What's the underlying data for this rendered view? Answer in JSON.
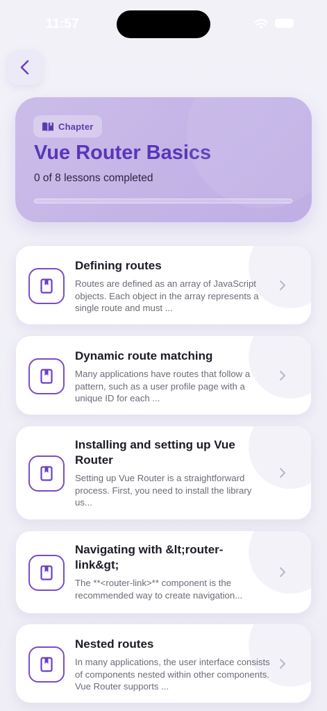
{
  "status_bar": {
    "time": "11:57"
  },
  "header": {
    "back_label": ""
  },
  "chapter": {
    "badge": "Chapter",
    "title": "Vue Router Basics",
    "progress_text": "0 of 8 lessons completed",
    "progress_fraction": 0
  },
  "lessons": [
    {
      "title": "Defining routes",
      "description": "Routes are defined as an array of JavaScript objects. Each object in the array represents a single route and must ..."
    },
    {
      "title": "Dynamic route matching",
      "description": "Many applications have routes that follow a pattern, such as a user profile page with a unique ID for each ..."
    },
    {
      "title": "Installing and setting up Vue Router",
      "description": "Setting up Vue Router is a straightforward process. First, you need to install the library us..."
    },
    {
      "title": "Navigating with &lt;router-link&gt;",
      "description": "The **<router-link>** component is the recommended way to create navigation..."
    },
    {
      "title": "Nested routes",
      "description": "In many applications, the user interface consists of components nested within other components. Vue Router supports ..."
    }
  ],
  "colors": {
    "accent": "#6b3fc4",
    "card_background": "#c7b8e8",
    "text_primary": "#1d1a26"
  }
}
